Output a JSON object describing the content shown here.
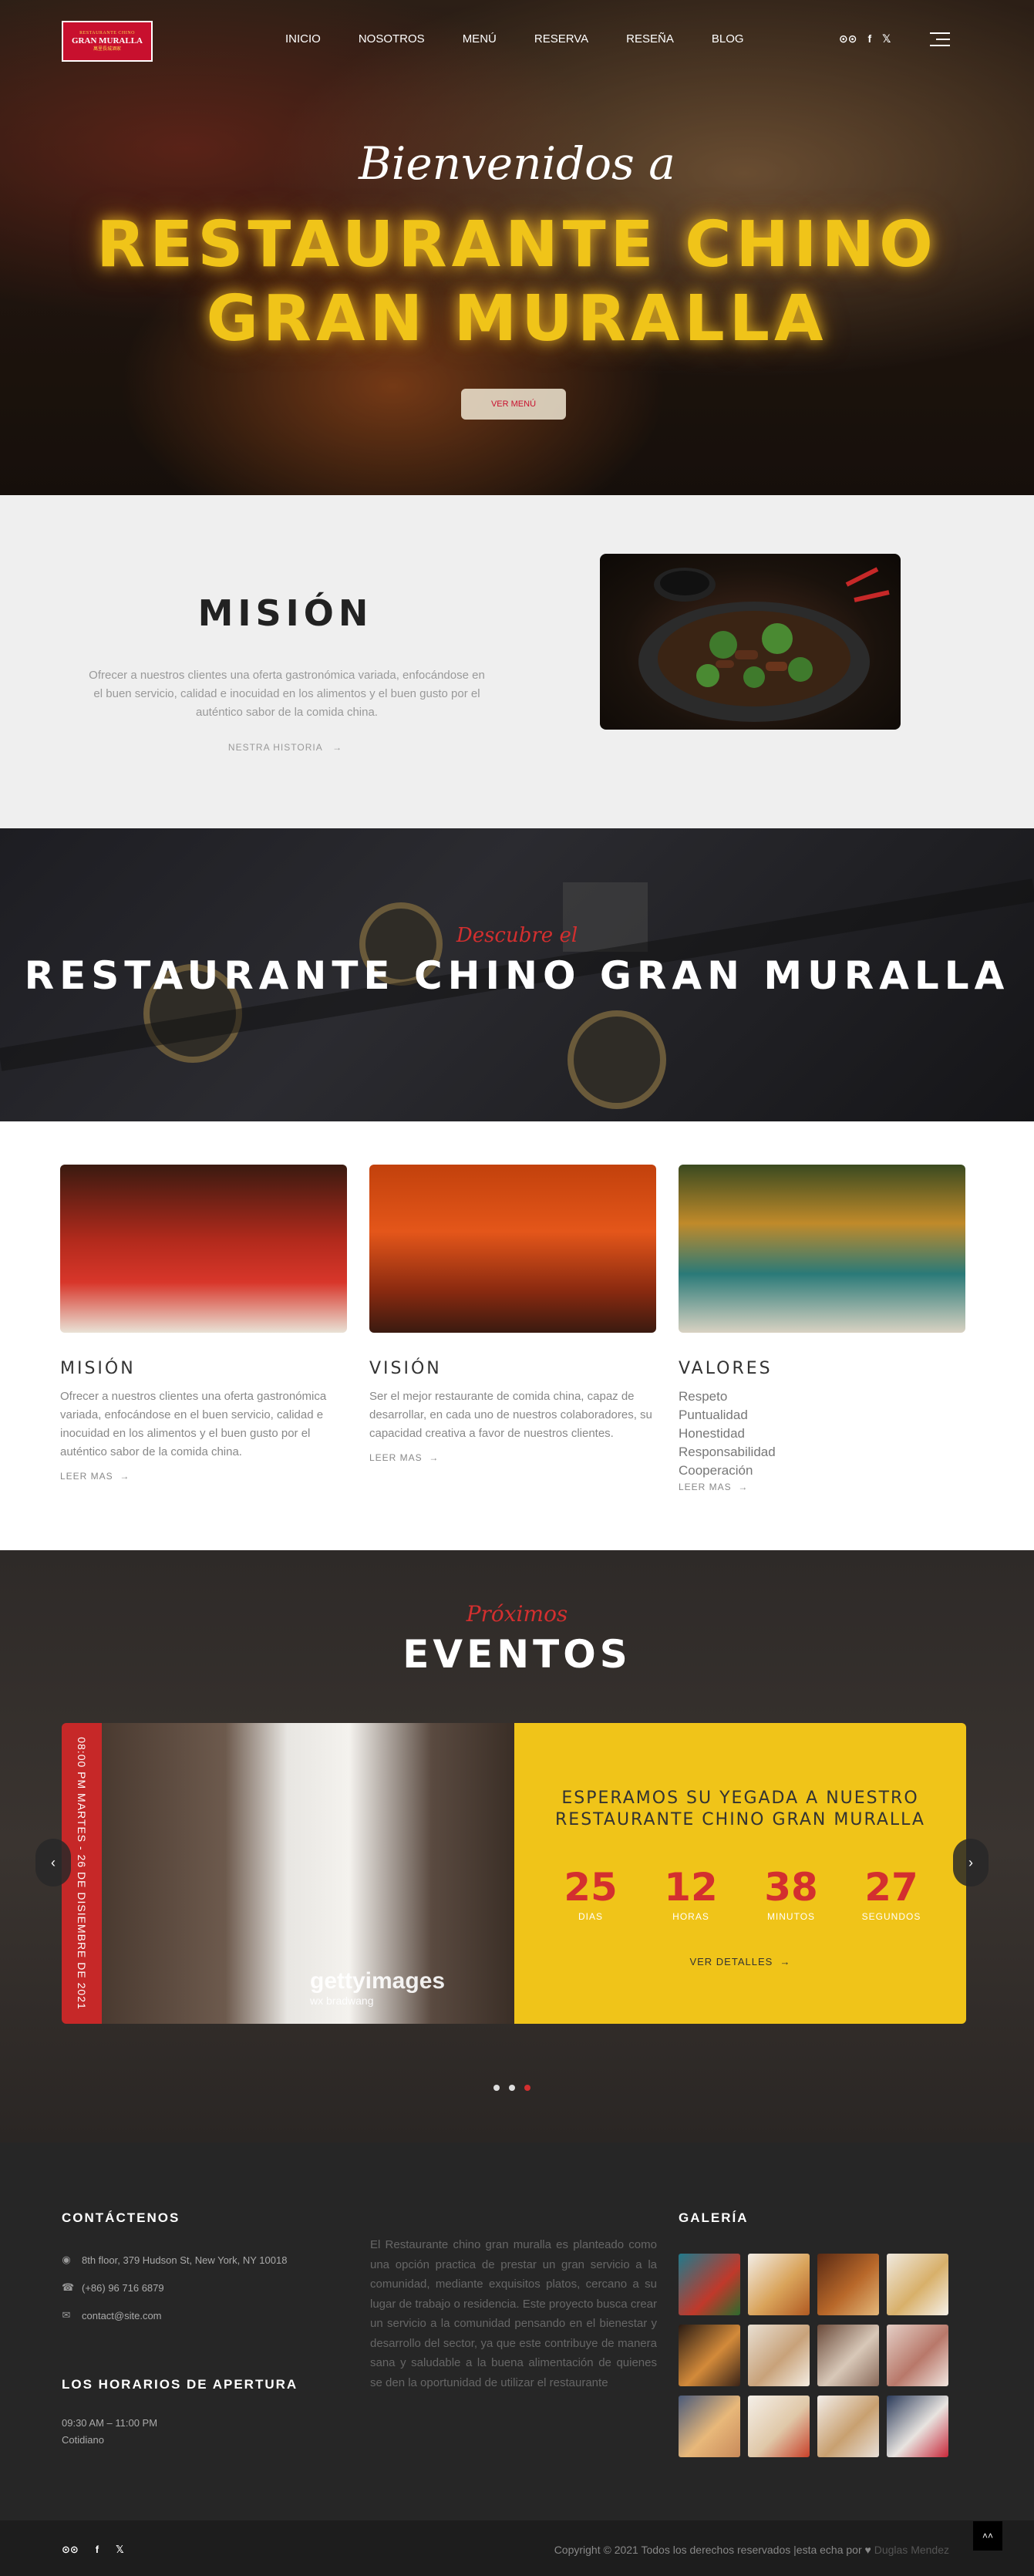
{
  "logo": {
    "top": "RESTAURANTE CHINO",
    "name": "GRAN MURALLA",
    "bottom": "萬里長城酒家"
  },
  "nav": [
    "INICIO",
    "NOSOTROS",
    "MENÚ",
    "RESERVA",
    "RESEÑA",
    "BLOG"
  ],
  "hero": {
    "subtitle": "Bienvenidos a",
    "title_line1": "RESTAURANTE CHINO",
    "title_line2": "GRAN MURALLA",
    "button": "VER MENÚ"
  },
  "mision": {
    "title": "MISIÓN",
    "text": "Ofrecer a nuestros clientes una oferta gastronómica variada, enfocándose en el buen servicio, calidad e inocuidad en los alimentos y el buen gusto por el auténtico sabor de la comida china.",
    "link": "NESTRA HISTORIA"
  },
  "descubre": {
    "subtitle": "Descubre el",
    "title": "RESTAURANTE CHINO GRAN MURALLA"
  },
  "cards": [
    {
      "title": "MISIÓN",
      "text": "Ofrecer a nuestros clientes una oferta gastronómica variada, enfocándose en el buen servicio, calidad e inocuidad en los alimentos y el buen gusto por el auténtico sabor de la comida china.",
      "link": "LEER MAS"
    },
    {
      "title": "VISIÓN",
      "text": "Ser el mejor restaurante de comida china, capaz de desarrollar, en cada uno de nuestros colaboradores, su capacidad creativa a favor de nuestros clientes.",
      "link": "LEER MAS"
    },
    {
      "title": "VALORES",
      "items": [
        "Respeto",
        "Puntualidad",
        "Honestidad",
        "Responsabilidad",
        "Cooperación"
      ],
      "link": "LEER MAS"
    }
  ],
  "eventos": {
    "subtitle": "Próximos",
    "title": "EVENTOS",
    "date": "08:00 PM MARTES - 26 DE DISIEMBRE DE 2021",
    "watermark": "gettyimages",
    "watermark_credit": "wx bradwang",
    "heading_line1": "ESPERAMOS SU YEGADA A NUESTRO",
    "heading_line2": "RESTAURANTE CHINO GRAN MURALLA",
    "countdown": [
      {
        "value": "25",
        "label": "DIAS"
      },
      {
        "value": "12",
        "label": "HORAS"
      },
      {
        "value": "38",
        "label": "MINUTOS"
      },
      {
        "value": "27",
        "label": "SEGUNDOS"
      }
    ],
    "link": "VER DETALLES"
  },
  "footer": {
    "contact_title": "CONTÁCTENOS",
    "address": "8th floor, 379 Hudson St, New York, NY 10018",
    "phone": "(+86) 96 716 6879",
    "email": "contact@site.com",
    "hours_title": "LOS HORARIOS DE APERTURA",
    "hours": "09:30 AM – 11:00 PM",
    "days": "Cotidiano",
    "about": "El Restaurante chino gran muralla es planteado como una opción practica de prestar un gran servicio a la comunidad, mediante exquisitos platos, cercano a su lugar de trabajo o residencia. Este proyecto busca crear un servicio a la comunidad pensando en el bienestar y desarrollo del sector, ya que este contribuye de manera sana y saludable a la buena alimentación de quienes se den la oportunidad de utilizar el restaurante",
    "gallery_title": "GALERÍA",
    "copyright": "Copyright © 2021 Todos los derechos reservados |esta echa por",
    "author": "Duglas Mendez"
  },
  "colors": {
    "accent_red": "#d32f2f",
    "accent_yellow": "#f0c419",
    "footer_bg": "#262626"
  },
  "icons": [
    "tripadvisor-icon",
    "facebook-icon",
    "twitter-icon",
    "menu-icon",
    "arrow-right-icon",
    "location-icon",
    "phone-icon",
    "mail-icon",
    "heart-icon",
    "chevron-up-icon"
  ]
}
